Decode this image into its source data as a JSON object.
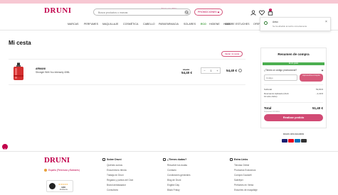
{
  "topbar": {
    "text": "Envío con glitter"
  },
  "header": {
    "logo": "DRUNI",
    "search_placeholder": "Busca productos o marcas",
    "promo_label": "PROMOCIONES",
    "cart_count": "1"
  },
  "nav": {
    "items": [
      "MARCAS",
      "PERFUMES",
      "MAQUILLAJE",
      "COSMÉTICA",
      "CABELLO",
      "PARAFARMACIA",
      "SOLARES",
      "ECO",
      "HIGIENE",
      "HOMBRE",
      "MÁS",
      "ESTUCHES",
      "OFERTAS"
    ]
  },
  "cart": {
    "title": "Mi cesta",
    "save_label": "Vaciar mi cesta",
    "item": {
      "brand": "ARMANI",
      "name": "Stronger With You Intensely 40ML",
      "old_price": "58,95€",
      "price": "54,40 €",
      "qty": "1",
      "minus": "−",
      "plus": "+",
      "line_total": "54,40 €",
      "info": "i"
    }
  },
  "summary": {
    "title": "Resumen de compra",
    "free_shipping": "Envío gratis",
    "promo_question": "¿Tienes un código promocional?",
    "code_placeholder": "Código",
    "apply_label": "Aprovecha el cupón",
    "subtotal_label": "Subtotal",
    "subtotal_value": "53,80 €",
    "discount_label": "Descuento Aplicado (Club",
    "discount_label2": "10 sólo clubs)",
    "discount_value": "- 2,40 €",
    "total_label": "Total",
    "total_value": "51,40 €",
    "tax_note": "Impuestos incluidos",
    "pay_label": "Realizar pedido",
    "secure_label": "PAGOS 100% SEGUROS",
    "cards": [
      "#1a1f71",
      "#eb001b",
      "#0070ba",
      "#333333"
    ]
  },
  "toast": {
    "title": "Aviso",
    "message": "Se ha añadido al carrito correctamente"
  },
  "footer": {
    "logo": "DRUNI",
    "language": "España (Península y Baleares)",
    "trust": {
      "stars": "★★★★★",
      "score": "4,63",
      "quality": "Excelente"
    },
    "columns": [
      {
        "heading": "Sobre Druni",
        "items": [
          "Quiénes somos",
          "Encuentra tu tienda",
          "Trabaja en Druni",
          "Regalos y puntos del Club",
          "Brand ambassador",
          "Consultorio"
        ]
      },
      {
        "heading": "¿Tienes dudas?",
        "items": [
          "Resuelve tus dudas",
          "Contacto",
          "Condiciones generales",
          "Blog de Druni",
          "English Day",
          "Black Friday"
        ]
      },
      {
        "heading": "Extra Links",
        "items": [
          "Tiendas Online",
          "Productos Exclusivos",
          "Compra Goodwill",
          "Sabrifyer",
          "Perfumes en Venta",
          "Estuches de maquillaje"
        ]
      }
    ]
  }
}
